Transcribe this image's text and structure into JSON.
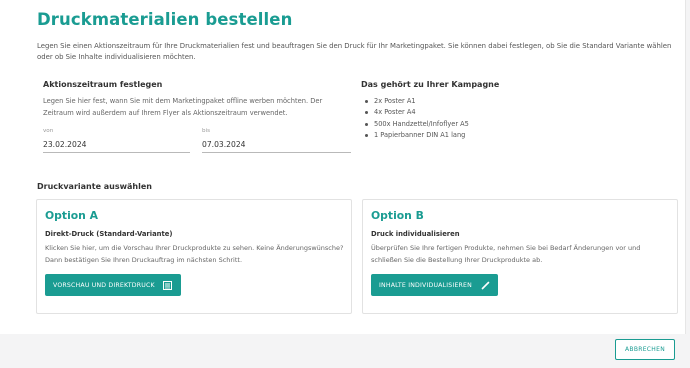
{
  "page": {
    "title": "Druckmaterialien bestellen",
    "intro": "Legen Sie einen Aktionszeitraum für Ihre Druckmaterialien fest und beauftragen Sie den Druck für Ihr Marketingpaket. Sie können dabei festlegen, ob Sie die Standard Variante wählen oder ob Sie Inhalte individualisieren möchten."
  },
  "period": {
    "title": "Aktionszeitraum festlegen",
    "description": "Legen Sie hier fest, wann Sie mit dem Marketingpaket offline werben möchten. Der Zeitraum wird außerdem auf Ihrem Flyer als Aktionszeitraum verwendet.",
    "from_label": "von",
    "from_value": "23.02.2024",
    "to_label": "bis",
    "to_value": "07.03.2024"
  },
  "campaign": {
    "title": "Das gehört zu Ihrer Kampagne",
    "items": [
      "2x Poster A1",
      "4x Poster A4",
      "500x Handzettel/Infoflyer A5",
      "1 Papierbanner DIN A1 lang"
    ]
  },
  "variant": {
    "title": "Druckvariante auswählen",
    "options": [
      {
        "title": "Option A",
        "subtitle": "Direkt-Druck (Standard-Variante)",
        "description": "Klicken Sie hier, um die Vorschau Ihrer Druckprodukte zu sehen. Keine Änderungswünsche? Dann bestätigen Sie Ihren Druckauftrag im nächsten Schritt.",
        "button": "VORSCHAU UND DIREKTDRUCK",
        "icon": "list-icon"
      },
      {
        "title": "Option B",
        "subtitle": "Druck individualisieren",
        "description": "Überprüfen Sie Ihre fertigen Produkte, nehmen Sie bei Bedarf Änderungen vor und schließen Sie die Bestellung Ihrer Druckprodukte ab.",
        "button": "INHALTE INDIVIDUALISIEREN",
        "icon": "pencil-icon"
      }
    ]
  },
  "footer": {
    "cancel": "ABBRECHEN"
  },
  "colors": {
    "accent": "#1a9c92",
    "background": "#f4f4f5"
  }
}
